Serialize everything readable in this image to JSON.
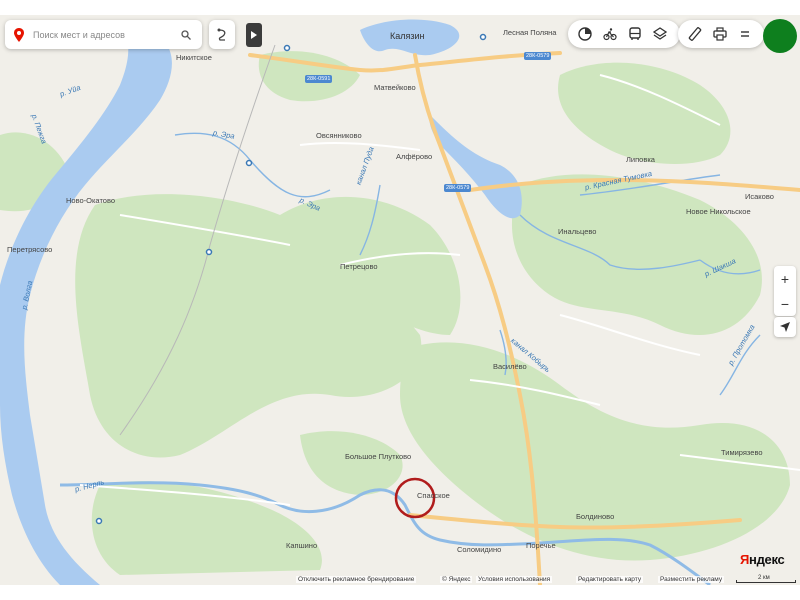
{
  "search": {
    "placeholder": "Поиск мест и адресов"
  },
  "toolbar_icons": [
    "traffic-icon",
    "cycling-icon",
    "transit-icon",
    "layers-icon"
  ],
  "tools_icons": [
    "ruler-icon",
    "print-icon",
    "menu-icon"
  ],
  "colors": {
    "profile": "#0e7f1e",
    "marker": "#b01c1c",
    "water": "#aacbf0",
    "forest": "#cfe6bf",
    "road_major": "#f7cc84",
    "road_minor": "#ffffff",
    "logo_red": "#e61400"
  },
  "map": {
    "places": {
      "kalyazin": "Калязин",
      "lesnaya_polyana": "Лесная Поляна",
      "nikitskoe": "Никитское",
      "matveykovo": "Матвейково",
      "ovsyannikovo": "Овсянниково",
      "alferovo": "Алфёрово",
      "lipovka": "Липовка",
      "isakovo": "Исаково",
      "novoe_nikolskoe": "Новое Никольское",
      "inaltsevo": "Инальцево",
      "novo_okatovo": "Ново-Окатово",
      "peretryasovo": "Перетрясово",
      "petretsovo": "Петрецово",
      "vasilevo": "Василёво",
      "timiryazevo": "Тимирязево",
      "bolshoe_plutkovo": "Большое Плутково",
      "spasskoe": "Спасское",
      "boldinovo": "Болдиново",
      "kapshino": "Капшино",
      "solomidino": "Соломидино",
      "porechye": "Поречье"
    },
    "rivers": {
      "uya": "р. Уйа",
      "pezhga": "р. Пежга",
      "era1": "р. Эра",
      "era2": "р. Эра",
      "pudy": "канал Пуда",
      "krasnaya_tumovka": "р. Красная Тумовка",
      "volga": "р. Волга",
      "shaksha": "р. Шакша",
      "kanal_kobyr": "канал Кобырь",
      "protomka": "р. Протомка",
      "nerl": "р. Нерль"
    },
    "shields": {
      "r1": "28К-0591",
      "r2": "28К-0579",
      "r3": "28К-0579"
    }
  },
  "controls": {
    "zoom_in": "+",
    "zoom_out": "−"
  },
  "logo": {
    "ya": "Я",
    "ndex": "ндекс"
  },
  "footer": {
    "disable_branding": "Отключить рекламное брендирование",
    "copyright": "© Яндекс",
    "terms": "Условия использования",
    "edit_map": "Редактировать карту",
    "place_ad": "Разместить рекламу",
    "scale": "2 км"
  }
}
